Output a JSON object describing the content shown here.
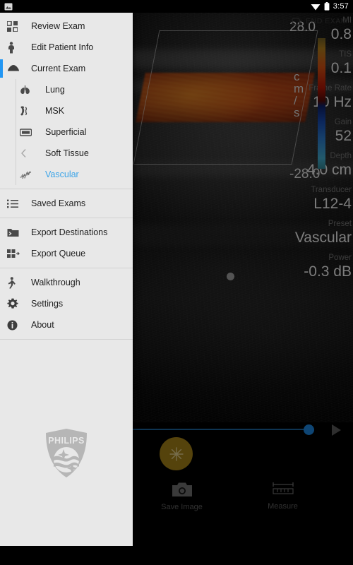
{
  "statusbar": {
    "notification_icon": "image-icon",
    "wifi_icon": "wifi-icon",
    "battery_icon": "battery-icon",
    "time": "3:57"
  },
  "header": {
    "end_exam_label": "END EXAM",
    "end_exam_icon": "end-exam-icon"
  },
  "drawer": {
    "items": [
      {
        "label": "Review Exam",
        "icon": "grid-icon",
        "level": "top",
        "selected": false
      },
      {
        "label": "Edit Patient Info",
        "icon": "person-icon",
        "level": "top",
        "selected": false
      },
      {
        "label": "Current Exam",
        "icon": "transducer-icon",
        "level": "top",
        "selected": false,
        "accent": true
      }
    ],
    "sub_items": [
      {
        "label": "Lung",
        "icon": "lungs-icon",
        "selected": false
      },
      {
        "label": "MSK",
        "icon": "msk-icon",
        "selected": false
      },
      {
        "label": "Superficial",
        "icon": "superficial-icon",
        "selected": false
      },
      {
        "label": "Soft Tissue",
        "icon": "soft-tissue-icon",
        "selected": false
      },
      {
        "label": "Vascular",
        "icon": "vascular-icon",
        "selected": true
      }
    ],
    "group_saved": [
      {
        "label": "Saved Exams",
        "icon": "list-icon"
      }
    ],
    "group_export": [
      {
        "label": "Export Destinations",
        "icon": "folder-export-icon"
      },
      {
        "label": "Export Queue",
        "icon": "grid-export-icon"
      }
    ],
    "group_misc": [
      {
        "label": "Walkthrough",
        "icon": "walking-icon"
      },
      {
        "label": "Settings",
        "icon": "gear-icon"
      },
      {
        "label": "About",
        "icon": "info-icon"
      }
    ],
    "logo": "philips-logo",
    "logo_text": "PHILIPS",
    "accent_color": "#2196f3",
    "selected_color": "#3ba4e8",
    "background_color": "#e8e8e8"
  },
  "imaging": {
    "velocity_top": "28.0",
    "velocity_bottom": "-28.0",
    "velocity_unit_line1": "c",
    "velocity_unit_line2": "m",
    "velocity_unit_line3": "/",
    "velocity_unit_line4": "s",
    "colorbar_icon": "doppler-colorbar",
    "box_handle_icon": "roi-handle"
  },
  "params": [
    {
      "label": "MI",
      "value": "0.8"
    },
    {
      "label": "TIS",
      "value": "0.1"
    },
    {
      "label": "Frame Rate",
      "value": "10 Hz"
    },
    {
      "label": "Gain",
      "value": "52"
    },
    {
      "label": "Depth",
      "value": "4.0 cm"
    },
    {
      "label": "Transducer",
      "value": "L12-4"
    },
    {
      "label": "Preset",
      "value": "Vascular"
    },
    {
      "label": "Power",
      "value": "-0.3 dB"
    }
  ],
  "controls": {
    "slider_icon": "cine-slider",
    "play_icon": "play-icon",
    "freeze_icon": "snowflake-icon",
    "buttons": [
      {
        "label": "Save Image",
        "icon": "camera-icon"
      },
      {
        "label": "Measure",
        "icon": "caliper-icon"
      }
    ],
    "accent_color": "#1b7fd4",
    "freeze_color": "#9c7a16"
  }
}
